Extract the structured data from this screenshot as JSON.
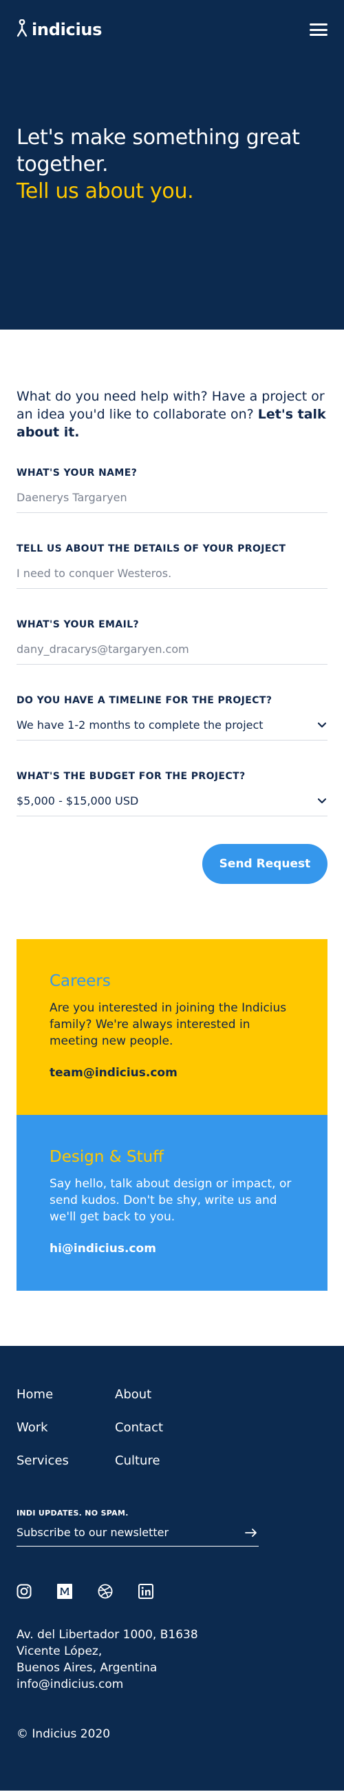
{
  "header": {
    "logo_text": "indicius",
    "icons": {
      "logo": "person-logo-icon",
      "menu": "hamburger-menu-icon"
    }
  },
  "hero": {
    "title_line": "Let's make something great together.",
    "accent_line": "Tell us about you."
  },
  "form": {
    "intro_text": "What do you need help with? Have a project or an idea you'd like to collaborate on?",
    "intro_bold": "Let's talk about it.",
    "fields": [
      {
        "label": "What's your name?",
        "placeholder": "Daenerys Targaryen"
      },
      {
        "label": "Tell us about the details of your project",
        "placeholder": "I need to conquer Westeros."
      },
      {
        "label": "What's your email?",
        "placeholder": "dany_dracarys@targaryen.com"
      }
    ],
    "selects": [
      {
        "label": "Do you have a timeline for the project?",
        "value": "We have 1-2 months to complete the project"
      },
      {
        "label": "What's the budget for the project?",
        "value": "$5,000 - $15,000 USD"
      }
    ],
    "submit_label": "Send Request"
  },
  "cards": [
    {
      "title": "Careers",
      "text": "Are you interested in joining the Indicius family? We're always interested in meeting new people.",
      "email": "team@indicius.com"
    },
    {
      "title": "Design & Stuff",
      "text": "Say hello, talk about design or impact, or send kudos. Don't be shy, write us and we'll get back to you.",
      "email": "hi@indicius.com"
    }
  ],
  "footer": {
    "nav": [
      "Home",
      "About",
      "Work",
      "Contact",
      "Services",
      "Culture"
    ],
    "newsletter_label": "INDI UPDATES. NO SPAM.",
    "newsletter_placeholder": "Subscribe to our newsletter",
    "social_icons": [
      "instagram-icon",
      "medium-icon",
      "dribbble-icon",
      "linkedin-icon"
    ],
    "address": [
      "Av. del Libertador 1000, B1638",
      "Vicente López,",
      "Buenos Aires, Argentina",
      "info@indicius.com"
    ],
    "copyright": "© Indicius 2020"
  },
  "colors": {
    "navy": "#0c2a4f",
    "yellow": "#ffc800",
    "blue": "#3597ec",
    "text_dark": "#10264a"
  }
}
